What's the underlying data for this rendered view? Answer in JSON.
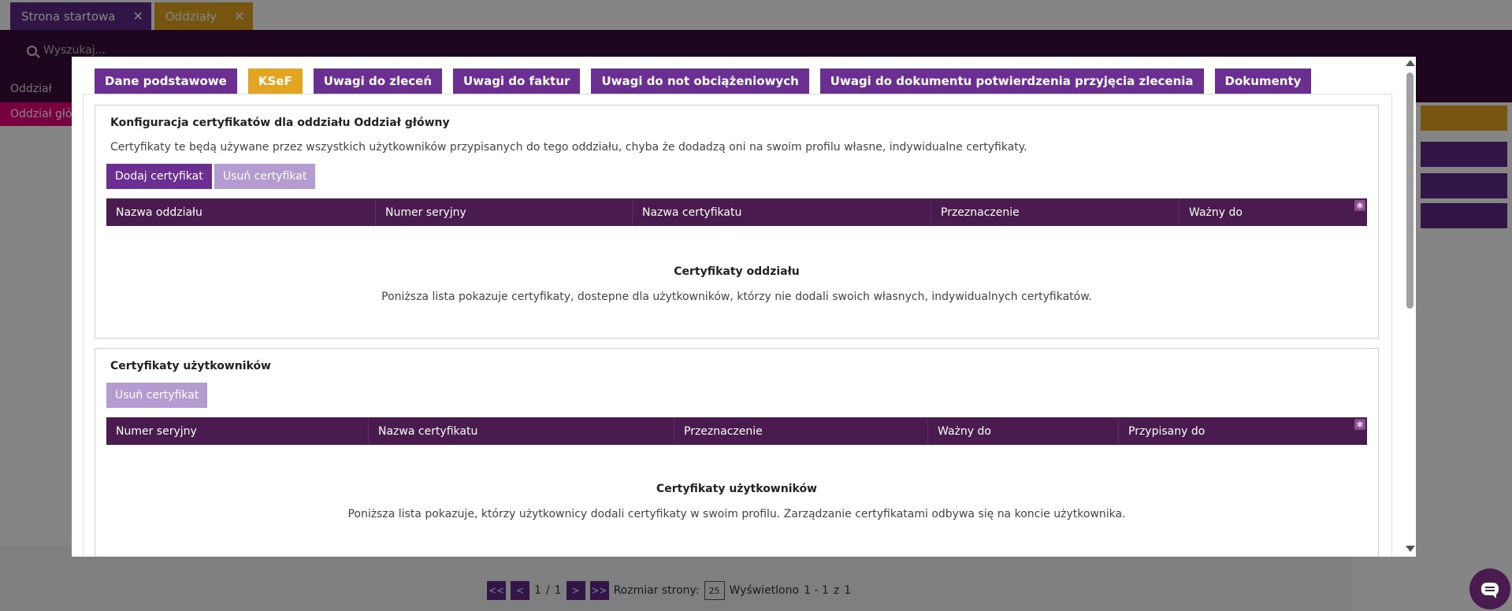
{
  "background": {
    "tabs": [
      {
        "label": "Strona startowa"
      },
      {
        "label": "Oddziały"
      }
    ],
    "search_placeholder": "Wyszukaj...",
    "row_header": "Oddział",
    "row_selected": "Oddział główny",
    "pager": {
      "first": "<<",
      "prev": "<",
      "page": "1",
      "separator": "/",
      "total_pages": "1",
      "next": ">",
      "last": ">>",
      "page_size_label": "Rozmiar strony:",
      "page_size": "25",
      "shown_label": "Wyświetlono",
      "shown_range": "1 - 1",
      "of_label": "z",
      "total": "1"
    }
  },
  "modal": {
    "tabs": [
      {
        "label": "Dane podstawowe",
        "active": false
      },
      {
        "label": "KSeF",
        "active": true
      },
      {
        "label": "Uwagi do zleceń",
        "active": false
      },
      {
        "label": "Uwagi do faktur",
        "active": false
      },
      {
        "label": "Uwagi do not obciążeniowych",
        "active": false
      },
      {
        "label": "Uwagi do dokumentu potwierdzenia przyjęcia zlecenia",
        "active": false
      },
      {
        "label": "Dokumenty",
        "active": false
      }
    ],
    "branch_panel": {
      "title": "Konfiguracja certyfikatów dla oddziału Oddział główny",
      "description": "Certyfikaty te będą używane przez wszystkich użytkowników przypisanych do tego oddziału, chyba że dodadzą oni na swoim profilu własne, indywidualne certyfikaty.",
      "add_button": "Dodaj certyfikat",
      "remove_button": "Usuń certyfikat",
      "columns": [
        "Nazwa oddziału",
        "Numer seryjny",
        "Nazwa certyfikatu",
        "Przeznaczenie",
        "Ważny do"
      ],
      "empty_title": "Certyfikaty oddziału",
      "empty_description": "Poniższa lista pokazuje certyfikaty, dostepne dla użytkowników, którzy nie dodali swoich własnych, indywidualnych certyfikatów."
    },
    "users_panel": {
      "title": "Certyfikaty użytkowników",
      "remove_button": "Usuń certyfikat",
      "columns": [
        "Numer seryjny",
        "Nazwa certyfikatu",
        "Przeznaczenie",
        "Ważny do",
        "Przypisany do"
      ],
      "empty_title": "Certyfikaty użytkowników",
      "empty_description": "Poniższa lista pokazuje, którzy użytkownicy dodali certyfikaty w swoim profilu. Zarządzanie certyfikatami odbywa się na koncie użytkownika."
    }
  },
  "icons": {
    "close": "close-icon",
    "search": "search-icon",
    "settings": "gear-icon",
    "chat": "chat-icon"
  },
  "colors": {
    "primary": "#6b2f91",
    "accent": "#e3a420",
    "header_dark": "#4a1b4f",
    "disabled_button": "#b49cd0",
    "magenta": "#e6007e"
  }
}
